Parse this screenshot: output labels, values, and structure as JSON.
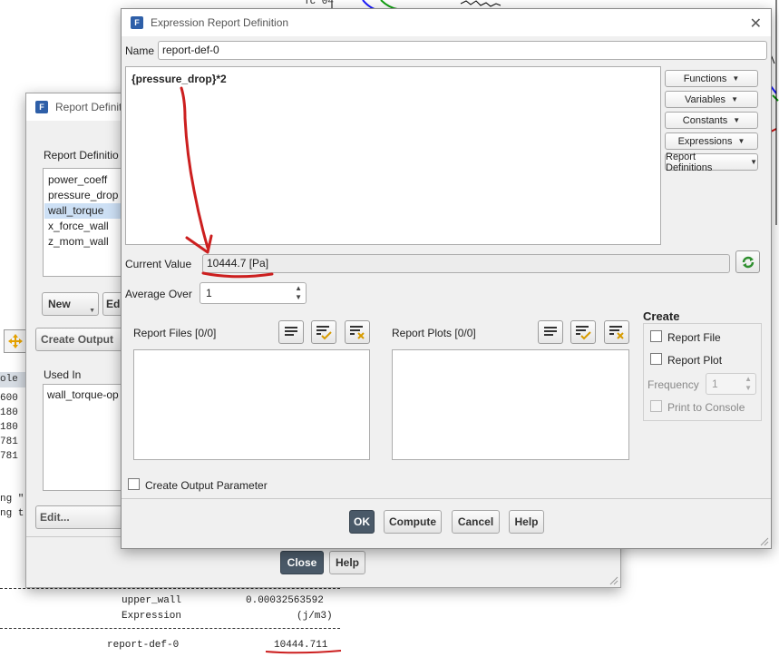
{
  "console": {
    "col_header": "ole",
    "left_values": [
      "600",
      "180",
      "180",
      "781",
      "781"
    ],
    "text_line_1": "ng \"",
    "text_line_2": "ng t",
    "tc_label": "Tc 04",
    "rows": [
      {
        "name": "upper_wall",
        "value": "0.00032563592"
      },
      {
        "name": "Expression",
        "value": "(j/m3)"
      },
      {
        "name": "report-def-0",
        "value": "10444.711"
      }
    ]
  },
  "report_definitions_window": {
    "title": "Report Definiti",
    "list_label": "Report Definitio",
    "items": [
      "power_coeff",
      "pressure_drop",
      "wall_torque",
      "x_force_wall",
      "z_mom_wall"
    ],
    "selected_index": 2,
    "new_label": "New",
    "edit_label_partial": "Edi",
    "create_output_label": "Create Output",
    "used_in_label": "Used In",
    "used_in_items": [
      "wall_torque-op"
    ],
    "edit_label": "Edit...",
    "close_label": "Close",
    "help_label": "Help"
  },
  "expr_window": {
    "title": "Expression Report Definition",
    "name_label": "Name",
    "name_value": "report-def-0",
    "expression": "{pressure_drop}*2",
    "side_buttons": [
      "Functions",
      "Variables",
      "Constants",
      "Expressions",
      "Report Definitions"
    ],
    "current_value_label": "Current Value",
    "current_value": "10444.7 [Pa]",
    "average_over_label": "Average Over",
    "average_over_value": "1",
    "report_files_label": "Report Files [0/0]",
    "report_plots_label": "Report Plots [0/0]",
    "create_label": "Create",
    "report_file_label": "Report File",
    "report_plot_label": "Report Plot",
    "frequency_label": "Frequency",
    "frequency_value": "1",
    "print_to_console_label": "Print to Console",
    "create_output_parameter_label": "Create Output Parameter",
    "ok_label": "OK",
    "compute_label": "Compute",
    "cancel_label": "Cancel",
    "help_label": "Help"
  },
  "colors": {
    "annotation": "#cc1f1f",
    "selected_row": "#cde0f5",
    "dark_button": "#4a5968"
  }
}
